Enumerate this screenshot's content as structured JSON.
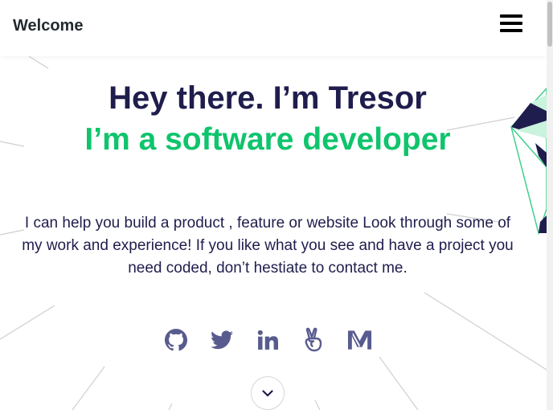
{
  "navbar": {
    "brand": "Welcome",
    "menu_icon": "hamburger-menu-icon"
  },
  "hero": {
    "title": "Hey there. I’m Tresor",
    "subtitle": "I’m a software developer",
    "description": "I can help you build a product , feature or website Look through some of my work and experience! If you like what you see and have a project you need coded, don’t hestiate to contact me."
  },
  "socials": [
    {
      "icon": "github-icon"
    },
    {
      "icon": "twitter-icon"
    },
    {
      "icon": "linkedin-icon"
    },
    {
      "icon": "angellist-icon"
    },
    {
      "icon": "medium-icon"
    }
  ],
  "scroll_down": {
    "icon": "chevron-down-icon"
  },
  "colors": {
    "title": "#1f1d4d",
    "accent": "#0fc46c",
    "icons": "#585b8e",
    "brand": "#222a2e"
  }
}
